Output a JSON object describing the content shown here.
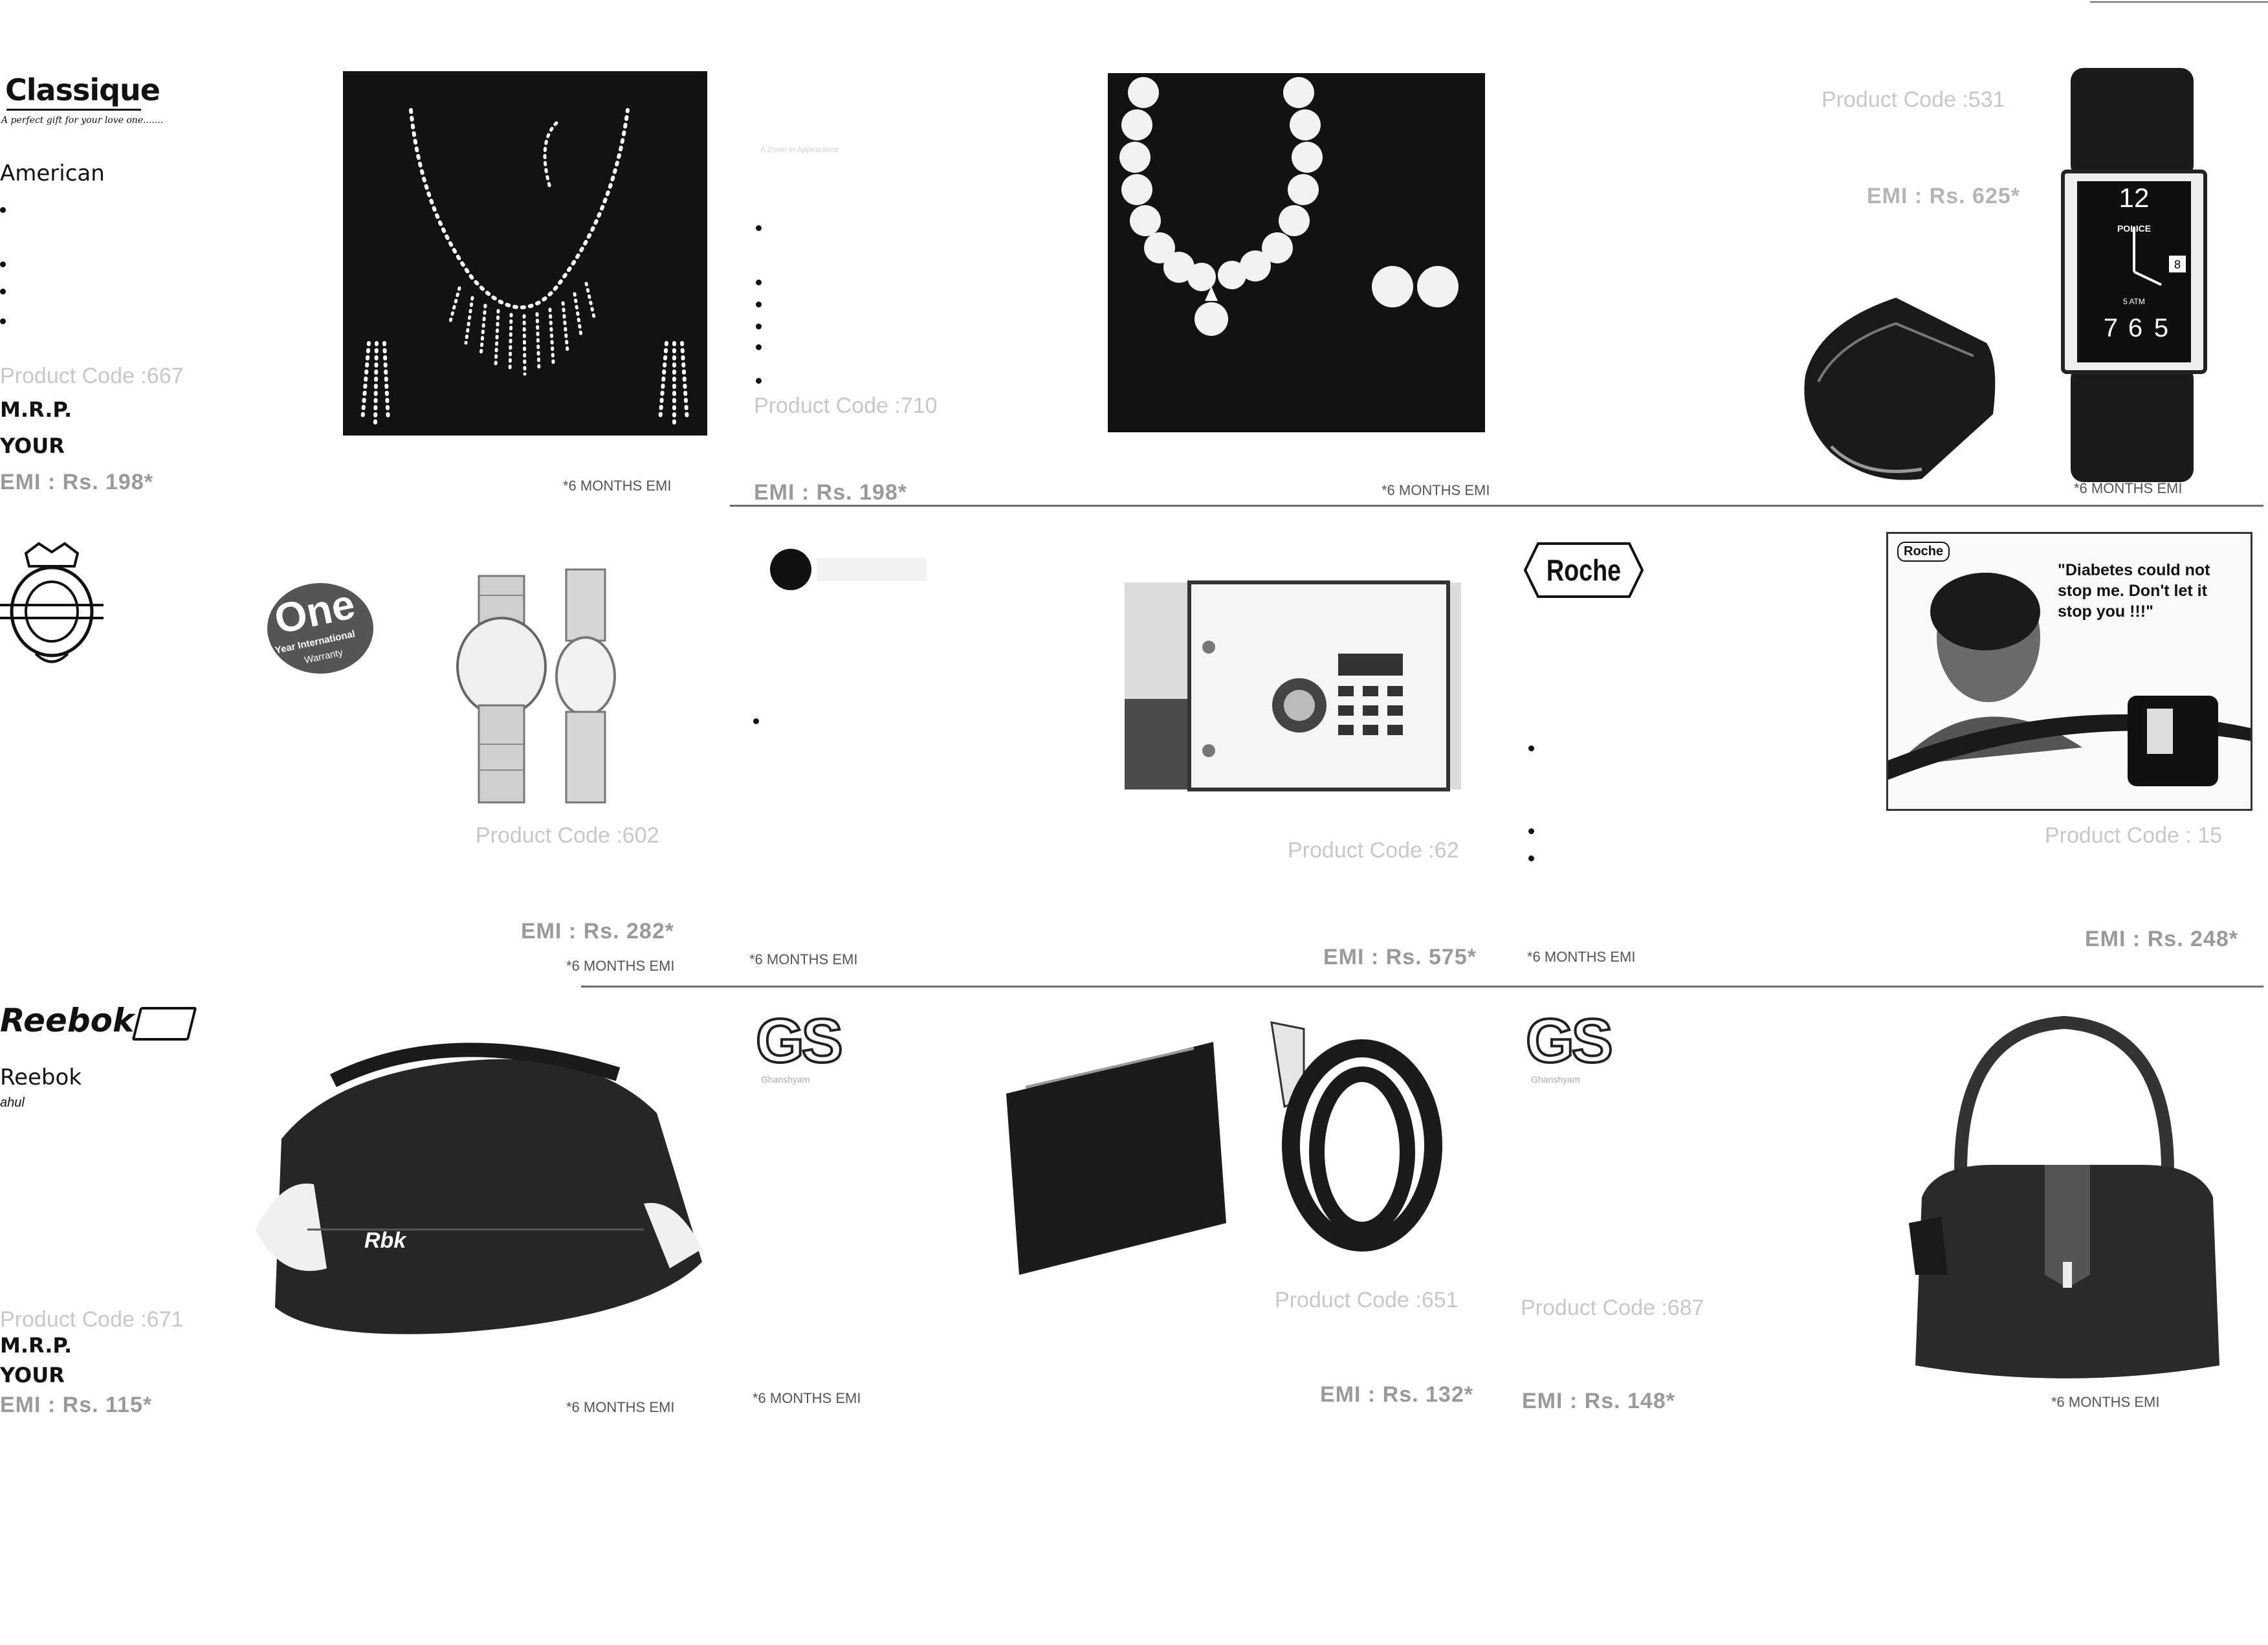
{
  "row1": {
    "classique": {
      "brand": "Classique",
      "tagline": "A perfect gift for your love one.......",
      "line1": "American",
      "product_code": "Product Code :667",
      "mrp_label": "M.R.P.",
      "your_label": "YOUR",
      "emi": "EMI : Rs. 198*"
    },
    "necklace": {
      "months": "*6 MONTHS EMI"
    },
    "pearl": {
      "tiny_text": "A Zoom in Appearance",
      "product_code": "Product Code :710",
      "emi": "EMI : Rs. 198*",
      "months": "*6 MONTHS EMI"
    },
    "watch": {
      "product_code": "Product Code :531",
      "emi": "EMI : Rs. 625*",
      "dial_brand": "POLICE",
      "dial_12": "12",
      "dial_6": "6",
      "dial_5": "5",
      "dial_7": "7",
      "dial_date": "8",
      "dial_atm": "5 ATM",
      "months": "*6 MONTHS EMI"
    }
  },
  "row2": {
    "wristwatch": {
      "badge_big": "One",
      "badge_line1": "Year International",
      "badge_line2": "Warranty",
      "product_code": "Product Code :602",
      "emi": "EMI : Rs. 282*",
      "months": "*6 MONTHS EMI"
    },
    "safe": {
      "product_code": "Product Code :62",
      "emi": "EMI : Rs. 575*",
      "months": "*6 MONTHS EMI"
    },
    "roche": {
      "logo": "Roche",
      "ad_logo": "Roche",
      "quote": "\"Diabetes could not stop me. Don't let it stop you !!!\"",
      "product_code": "Product Code : 15",
      "emi": "EMI : Rs. 248*",
      "months": "*6 MONTHS EMI"
    }
  },
  "row3": {
    "reebok": {
      "logo": "Reebok",
      "line1": "Reebok",
      "line2": "ahul",
      "bag_mark": "Rbk",
      "product_code": "Product Code :671",
      "mrp_label": "M.R.P.",
      "your_label": "YOUR",
      "emi": "EMI : Rs. 115*",
      "months": "*6 MONTHS EMI"
    },
    "wallet": {
      "gs_logo": "GS",
      "gs_sub": "Ghanshyam",
      "product_code": "Product Code :651",
      "emi": "EMI : Rs. 132*",
      "months": "*6 MONTHS EMI"
    },
    "handbag": {
      "gs_logo": "GS",
      "gs_sub": "Ghanshyam",
      "product_code": "Product Code :687",
      "emi": "EMI : Rs. 148*",
      "months": "*6 MONTHS EMI"
    }
  }
}
